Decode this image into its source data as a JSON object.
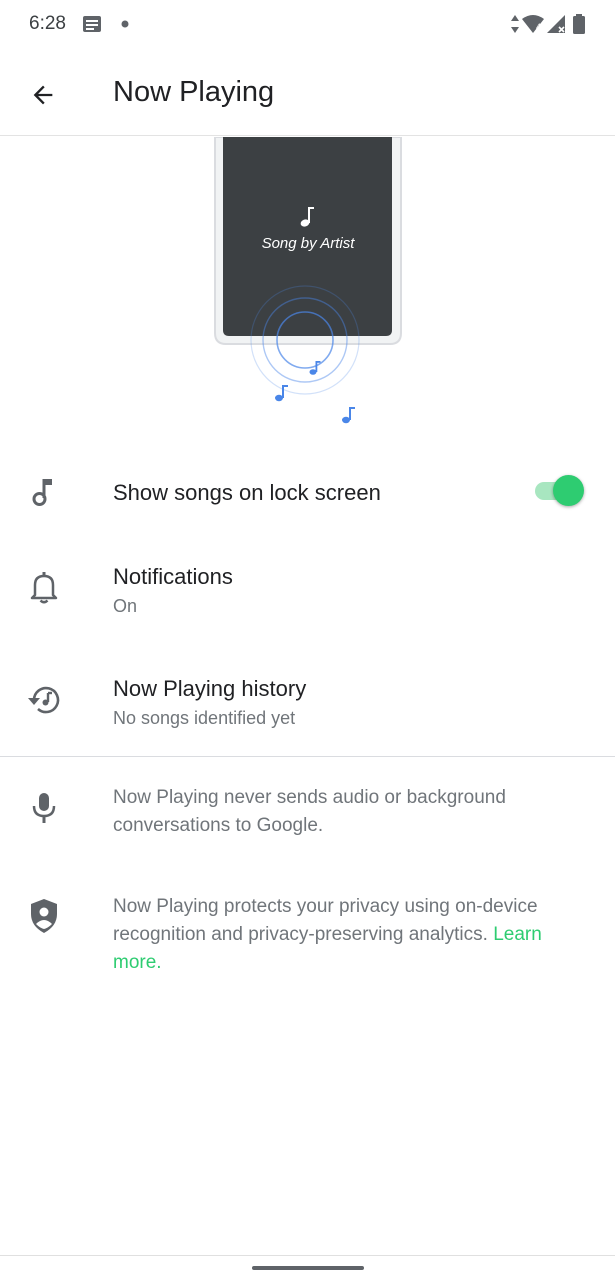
{
  "status_bar": {
    "time": "6:28",
    "left_icons": [
      "message-icon",
      "dot-icon"
    ],
    "right_icons": [
      "data-arrows-icon",
      "wifi-icon",
      "cell-signal-icon",
      "battery-icon"
    ],
    "wifi_badge": "4"
  },
  "app_bar": {
    "title": "Now Playing",
    "back_icon": "arrow-back-icon"
  },
  "illustration": {
    "song_text": "Song by Artist",
    "accent_color": "#4a86e8"
  },
  "settings": {
    "lock_screen": {
      "label": "Show songs on lock screen",
      "icon": "music-note-icon",
      "toggle_on": true
    },
    "notifications": {
      "label": "Notifications",
      "value": "On",
      "icon": "bell-icon"
    },
    "history": {
      "label": "Now Playing history",
      "value": "No songs identified yet",
      "icon": "history-icon"
    }
  },
  "info": {
    "audio": {
      "icon": "mic-icon",
      "text": "Now Playing never sends audio or background conversations to Google."
    },
    "privacy": {
      "icon": "shield-person-icon",
      "text": "Now Playing protects your privacy using on-device recognition and privacy-preserving analytics.",
      "link": "Learn more."
    }
  },
  "colors": {
    "accent": "#2ecc71",
    "text_primary": "#202124",
    "text_secondary": "#70757a"
  }
}
